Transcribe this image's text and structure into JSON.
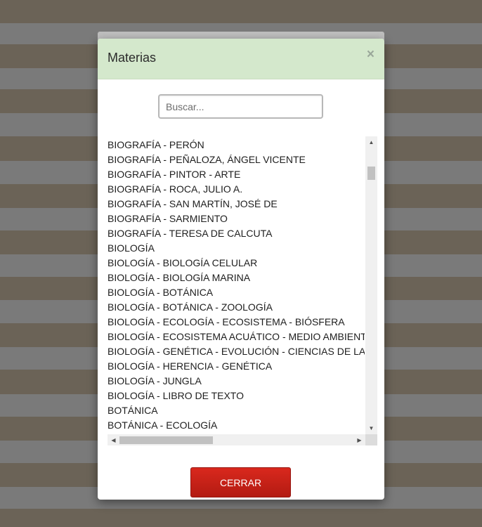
{
  "modal": {
    "title": "Materias",
    "close_symbol": "×",
    "search_placeholder": "Buscar...",
    "close_button_label": "CERRAR"
  },
  "list": {
    "items": [
      "BIOGRAFÍA - PERÓN",
      "BIOGRAFÍA - PEÑALOZA, ÁNGEL VICENTE",
      "BIOGRAFÍA - PINTOR - ARTE",
      "BIOGRAFÍA - ROCA, JULIO A.",
      "BIOGRAFÍA - SAN MARTÍN, JOSÉ DE",
      "BIOGRAFÍA - SARMIENTO",
      "BIOGRAFÍA - TERESA DE CALCUTA",
      "BIOLOGÍA",
      "BIOLOGÍA - BIOLOGÍA CELULAR",
      "BIOLOGÍA - BIOLOGÍA MARINA",
      "BIOLOGÍA - BOTÁNICA",
      "BIOLOGÍA - BOTÁNICA - ZOOLOGÍA",
      "BIOLOGÍA - ECOLOGÍA - ECOSISTEMA - BIÓSFERA",
      "BIOLOGÍA - ECOSISTEMA ACUÁTICO - MEDIO AMBIENTE",
      "BIOLOGÍA - GENÉTICA - EVOLUCIÓN - CIENCIAS DE LA",
      "BIOLOGÍA - HERENCIA - GENÉTICA",
      "BIOLOGÍA - JUNGLA",
      "BIOLOGÍA - LIBRO DE TEXTO",
      "BOTÁNICA",
      "BOTÁNICA - ECOLOGÍA"
    ]
  },
  "scrollbar_icons": {
    "up": "▲",
    "down": "▼",
    "left": "◀",
    "right": "▶"
  },
  "colors": {
    "header_bg": "#d4e8cc",
    "button_red": "#c8211a",
    "stripe_brown": "#6b6357",
    "stripe_gray": "#7a7a7a"
  }
}
